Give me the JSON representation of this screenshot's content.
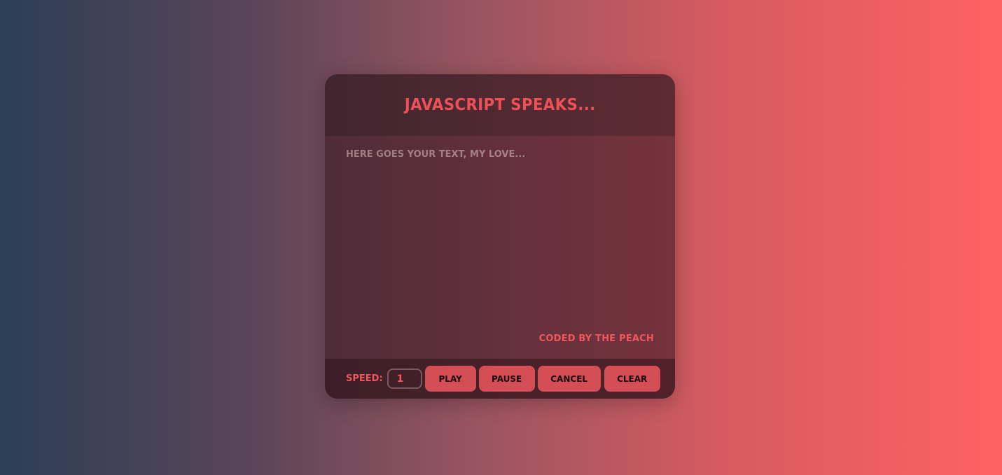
{
  "app": {
    "title": "JavaScript Speaks..."
  },
  "editor": {
    "value": "",
    "placeholder": "Here goes your text, my love...",
    "credit": "Coded by The Peach"
  },
  "controls": {
    "speed_label": "Speed:",
    "speed_value": "1",
    "play_label": "Play",
    "pause_label": "Pause",
    "cancel_label": "Cancel",
    "clear_label": "Clear"
  },
  "colors": {
    "accent": "#ee5058",
    "button_bg": "#d44e56",
    "gradient_start": "#2b3f56",
    "gradient_end": "#ff6262"
  }
}
